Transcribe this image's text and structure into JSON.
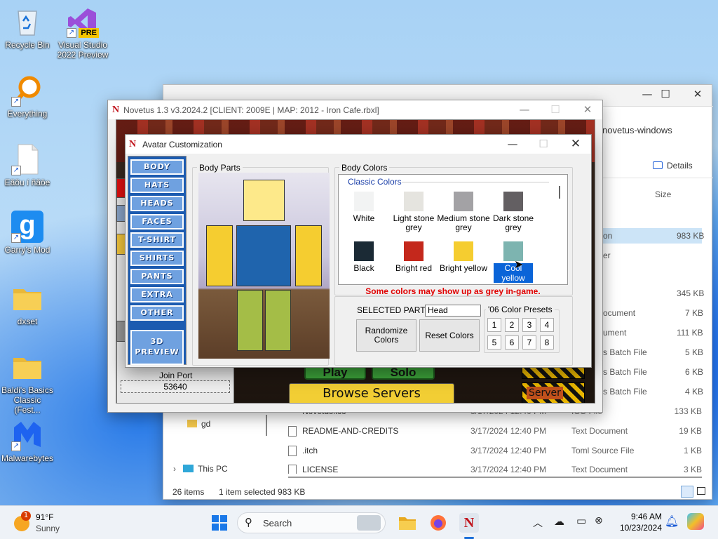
{
  "desktop_icons": [
    {
      "label": "Recycle Bin",
      "name": "recycle-bin"
    },
    {
      "label": "Visual Studio 2022 Preview",
      "name": "visual-studio"
    },
    {
      "label": "Everything",
      "name": "everything"
    },
    {
      "label": "Eãõu í ñãöe",
      "name": "document"
    },
    {
      "label": "Garry's Mod",
      "name": "garrys-mod"
    },
    {
      "label": "dxset",
      "name": "dxset-folder"
    },
    {
      "label": "Baldi's Basics Classic (Fest...",
      "name": "baldis-folder"
    },
    {
      "label": "Malwarebytes",
      "name": "malwarebytes"
    }
  ],
  "vs_badge": "PRE",
  "explorer": {
    "path_title": "novetus-windows",
    "details_label": "Details",
    "size_header": "Size",
    "sizes": [
      "983 KB",
      "345 KB",
      "7 KB",
      "111 KB",
      "5 KB",
      "6 KB",
      "4 KB"
    ],
    "partial_types": [
      "on",
      "er",
      "",
      "ocument",
      "ument",
      "s Batch File",
      "s Batch File",
      "s Batch File"
    ],
    "rows": [
      {
        "name": "Novetus.ico",
        "date": "3/17/2024 12:40 PM",
        "type": "ICO File",
        "size": "133 KB"
      },
      {
        "name": "README-AND-CREDITS",
        "date": "3/17/2024 12:40 PM",
        "type": "Text Document",
        "size": "19 KB"
      },
      {
        "name": ".itch",
        "date": "3/17/2024 12:40 PM",
        "type": "Toml Source File",
        "size": "1 KB"
      },
      {
        "name": "LICENSE",
        "date": "3/17/2024 12:40 PM",
        "type": "Text Document",
        "size": "3 KB"
      }
    ],
    "nav_gd": "gd",
    "nav_thispc": "This PC",
    "status_items": "26 items",
    "status_selected": "1 item selected  983 KB"
  },
  "novetus": {
    "title": "Novetus 1.3 v3.2024.2 [CLIENT: 2009E | MAP: 2012 - Iron Cafe.rbxl]",
    "logo": "N",
    "join_port_label": "Join Port",
    "join_port_value": "53640",
    "browse_servers": "Browse Servers",
    "play_label": "Play",
    "solo_label": "Solo",
    "server_label": "Server"
  },
  "avatar": {
    "title": "Avatar Customization",
    "logo": "N",
    "sidebar": [
      "BODY",
      "HATS",
      "HEADS",
      "FACES",
      "T-SHIRT",
      "SHIRTS",
      "PANTS",
      "EXTRA",
      "OTHER"
    ],
    "preview_btn": "3D PREVIEW",
    "body_parts_label": "Body Parts",
    "body_colors_label": "Body Colors",
    "classic_colors_label": "Classic Colors",
    "colors": [
      {
        "label": "White",
        "hex": "#f2f3f3"
      },
      {
        "label": "Light stone grey",
        "hex": "#e5e4df"
      },
      {
        "label": "Medium stone grey",
        "hex": "#a3a2a5"
      },
      {
        "label": "Dark stone grey",
        "hex": "#635f62"
      },
      {
        "label": "Black",
        "hex": "#1b2a35"
      },
      {
        "label": "Bright red",
        "hex": "#c4281c"
      },
      {
        "label": "Bright yellow",
        "hex": "#f5cd30"
      },
      {
        "label": "Cool yellow",
        "hex": "#7db4b0"
      }
    ],
    "warning": "Some colors may show up as grey in-game.",
    "selected_part_label": "SELECTED PART:",
    "selected_part_value": "Head",
    "randomize": "Randomize Colors",
    "reset": "Reset Colors",
    "presets_label": "'06 Color Presets",
    "presets": [
      "1",
      "2",
      "3",
      "4",
      "5",
      "6",
      "7",
      "8"
    ],
    "body_colors": {
      "head": "#fde98a",
      "torso": "#1f64ad",
      "arms": "#f5cd30",
      "legs": "#a4bd47"
    }
  },
  "taskbar": {
    "weather_temp": "91°F",
    "weather_desc": "Sunny",
    "weather_badge": "1",
    "search_placeholder": "Search",
    "time": "9:46 AM",
    "date": "10/23/2024"
  }
}
